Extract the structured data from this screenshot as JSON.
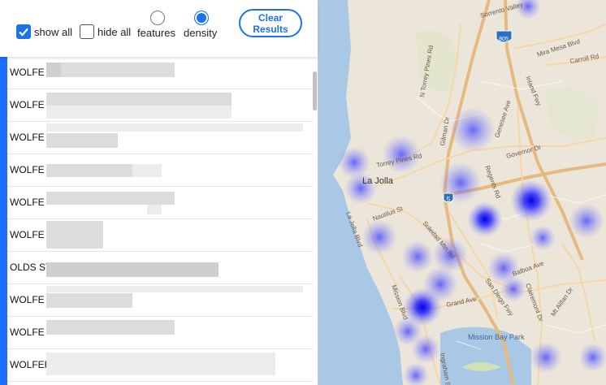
{
  "controls": {
    "show_all_label": "show all",
    "hide_all_label": "hide all",
    "features_label": "features",
    "density_label": "density",
    "clear_results_label": "Clear\nResults"
  },
  "results": [
    {
      "name": "WOLFE"
    },
    {
      "name": "WOLFE"
    },
    {
      "name": "WOLFE"
    },
    {
      "name": "WOLFE"
    },
    {
      "name": "WOLFE"
    },
    {
      "name": "WOLFE"
    },
    {
      "name": "OLDS ST"
    },
    {
      "name": "WOLFE"
    },
    {
      "name": "WOLFE"
    },
    {
      "name": "WOLFER"
    }
  ],
  "map": {
    "labels": {
      "la_jolla": "La Jolla",
      "torrey_pines_rd": "Torrey Pines Rd",
      "n_torrey_pines_rd": "N Torrey Pines Rd",
      "gilman_dr": "Gilman Dr",
      "genesee_ave": "Genesee Ave",
      "governor_dr": "Governor Dr",
      "regents_rd": "Regents Rd",
      "nautilus_st": "Nautilus St",
      "la_jolla_blvd": "La Jolla Blvd",
      "soledad_mtn_rd": "Soledad Mtn Rd",
      "clairemont_dr": "Clairemont Dr",
      "balboa_ave": "Balboa Ave",
      "grand_ave": "Grand Ave",
      "mission_blvd": "Mission Blvd",
      "mission_bay_park": "Mission Bay Park",
      "mira_mesa_blvd": "Mira Mesa Blvd",
      "carroll_rd": "Carroll Rd",
      "sorrento_valley": "Sorrento Valley",
      "inland_fwy": "Inland Fwy",
      "san_diego_fwy": "San Diego Fwy",
      "ingraham_st": "Ingraham St",
      "mt_alifan_dr": "Mt Alifan Dr",
      "i5_shield": "5",
      "i805_shield": "805"
    }
  }
}
